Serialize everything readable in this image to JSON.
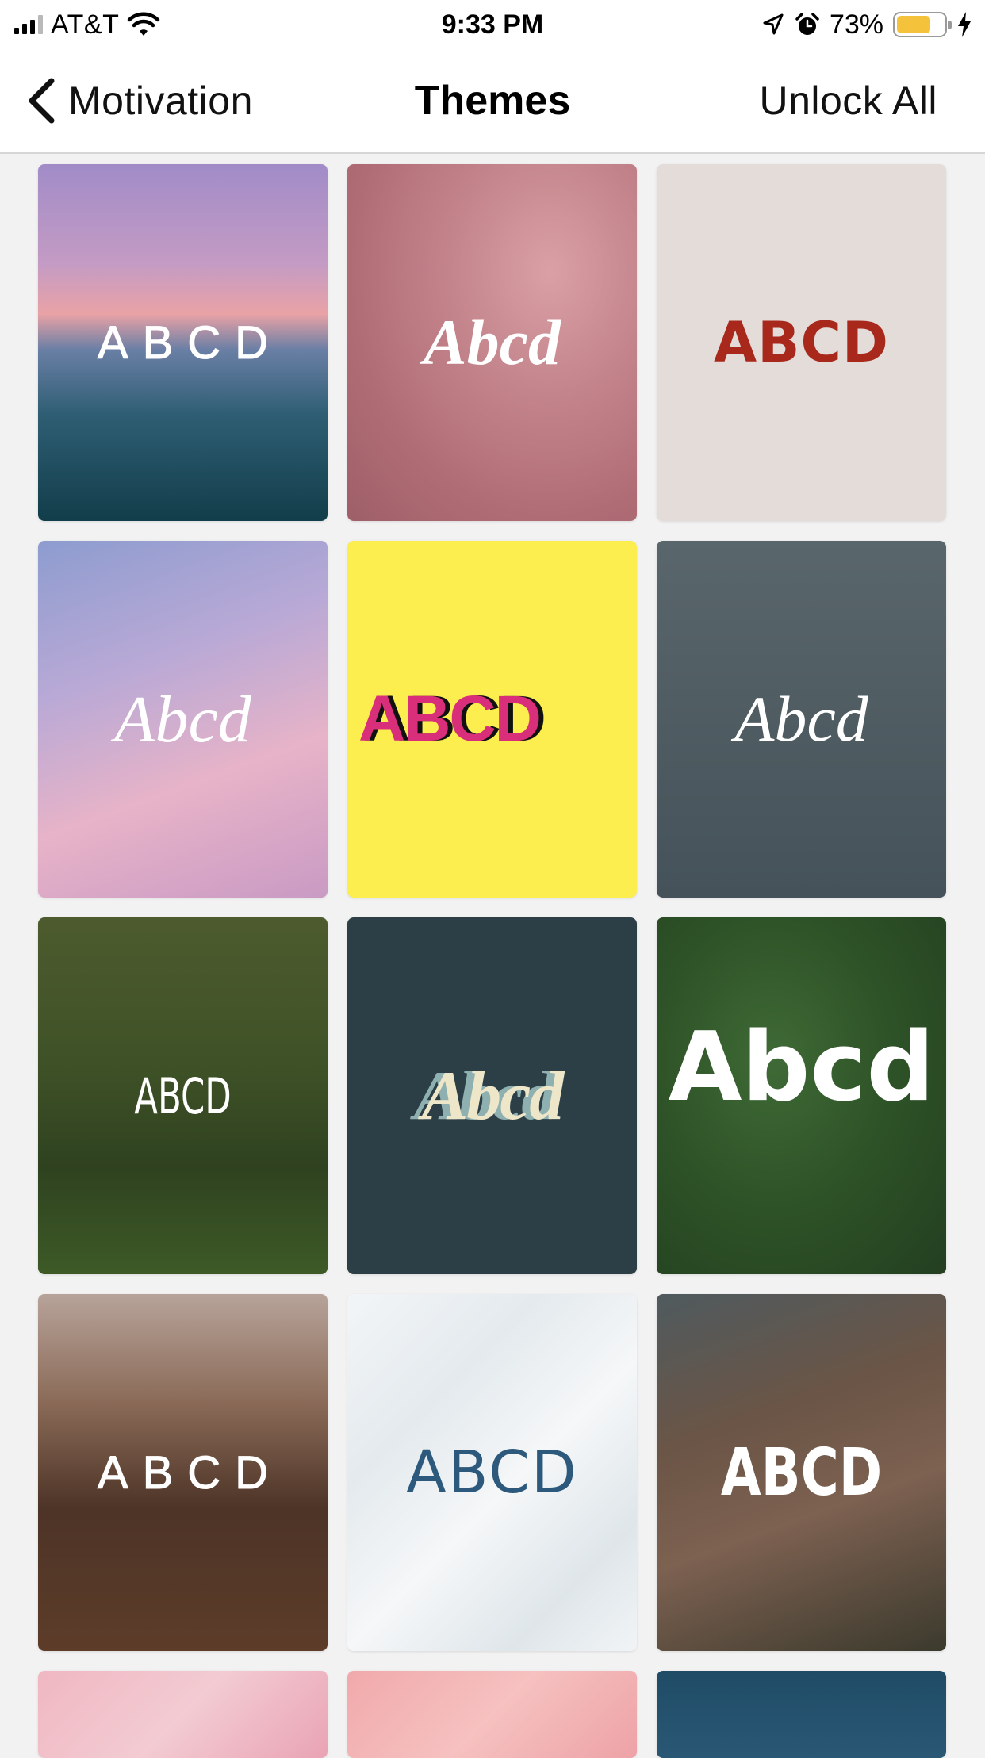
{
  "status_bar": {
    "carrier": "AT&T",
    "time": "9:33 PM",
    "battery_percent": "73%",
    "battery_level": 0.73,
    "icons": [
      "signal-icon",
      "wifi-icon",
      "location-arrow-icon",
      "alarm-icon",
      "battery-icon",
      "charging-bolt-icon"
    ]
  },
  "nav": {
    "back_label": "Motivation",
    "title": "Themes",
    "right_action": "Unlock All"
  },
  "themes": [
    {
      "sample": "ABCD",
      "background": "ocean sunset",
      "text_color": "#ffffff"
    },
    {
      "sample": "Abcd",
      "background": "pink satin",
      "text_color": "#ffffff"
    },
    {
      "sample": "ABCD",
      "background": "beige solid",
      "text_color": "#a8281c"
    },
    {
      "sample": "Abcd",
      "background": "palm trees pastel sky",
      "text_color": "#ffffff"
    },
    {
      "sample": "ABCD",
      "background": "yellow solid",
      "text_color": "#d92f7a"
    },
    {
      "sample": "Abcd",
      "background": "flower in water",
      "text_color": "#ffffff"
    },
    {
      "sample": "ABCD",
      "background": "forest tree",
      "text_color": "#ffffff"
    },
    {
      "sample": "Abcd",
      "background": "dark teal solid",
      "text_color": "#ede6c8"
    },
    {
      "sample": "Abcd",
      "background": "aerial forest road",
      "text_color": "#ffffff"
    },
    {
      "sample": "ABCD",
      "background": "meditation silhouette",
      "text_color": "#ffffff"
    },
    {
      "sample": "ABCD",
      "background": "white marble",
      "text_color": "#2d5a7c"
    },
    {
      "sample": "ABCD",
      "background": "canyon cliffs",
      "text_color": "#ffffff"
    }
  ],
  "partial_row": [
    {
      "background": "pink petals"
    },
    {
      "background": "pink feathers"
    },
    {
      "background": "deep sea"
    }
  ]
}
